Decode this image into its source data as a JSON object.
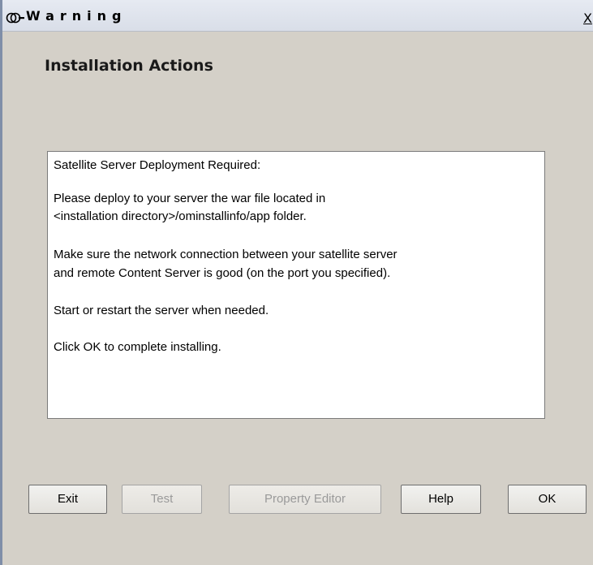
{
  "window": {
    "title": "Warning",
    "close_label": "X"
  },
  "main": {
    "heading": "Installation Actions",
    "message_lines": [
      "Satellite Server Deployment Required:",
      " Please deploy to your server the war file located in",
      "<installation directory>/ominstallinfo/app folder.",
      " Make sure the network connection between your satellite server",
      "and remote Content Server is good (on the port you specified).",
      " Start or restart the server when needed.",
      "Click OK to complete installing."
    ]
  },
  "buttons": {
    "exit": {
      "label": "Exit",
      "enabled": true
    },
    "test": {
      "label": "Test",
      "enabled": false
    },
    "property_editor": {
      "label": "Property Editor",
      "enabled": false
    },
    "help": {
      "label": "Help",
      "enabled": true
    },
    "ok": {
      "label": "OK",
      "enabled": true
    }
  },
  "icons": {
    "title_icon": "app-logo-icon"
  }
}
